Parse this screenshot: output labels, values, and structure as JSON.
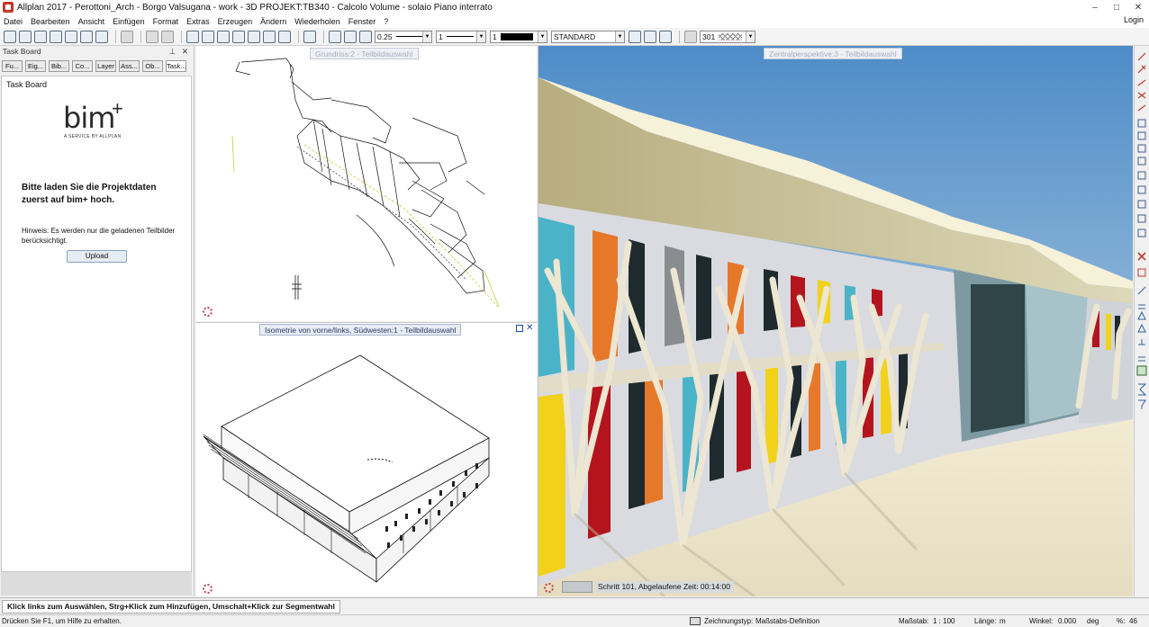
{
  "window": {
    "title": "Allplan 2017 - Perottoni_Arch - Borgo Valsugana - work - 3D PROJEKT:TB340 - Calcolo Volume - solaio Piano interrato",
    "minimize": "–",
    "maximize": "□",
    "close": "✕"
  },
  "menu": {
    "items": [
      "Datei",
      "Bearbeiten",
      "Ansicht",
      "Einfügen",
      "Format",
      "Extras",
      "Erzeugen",
      "Ändern",
      "Wiederholen",
      "Fenster",
      "?"
    ],
    "login": "Login"
  },
  "toolbar": {
    "pen_value": "0.25",
    "line_value": "1",
    "color_value": "1",
    "layer_value": "STANDARD",
    "hatch_value": "301"
  },
  "palette": {
    "title": "Task Board",
    "pin": "⊥",
    "close": "✕",
    "tabs": [
      "Fu...",
      "Eig...",
      "Bib...",
      "Co...",
      "Layer",
      "Ass...",
      "Ob...",
      "Task..."
    ]
  },
  "taskboard": {
    "header": "Task Board",
    "logo": "bim",
    "logo_sup": "+",
    "logo_sub": "A SERVICE BY ALLPLAN",
    "heading": "Bitte laden Sie die Projektdaten zuerst auf bim+ hoch.",
    "note": "Hinweis: Es werden nur die geladenen Teilbilder berücksichtigt.",
    "upload_label": "Upload"
  },
  "viewports": {
    "plan_label": "Grundriss:2 - Teilbildauswahl",
    "iso_label": "Isometrie von vorne/links, Südwesten:1 - Teilbildauswahl",
    "persp_label": "Zentralperspektive:3 - Teilbildauswahl",
    "render_status": "Schritt 101, Abgelaufene Zeit: 00:14:00"
  },
  "command": {
    "message": "Klick links zum Auswählen, Strg+Klick zum Hinzufügen, Umschalt+Klick zur Segmentwahl"
  },
  "status": {
    "help": "Drücken Sie F1, um Hilfe zu erhalten.",
    "drawing_type_label": "Zeichnungstyp:",
    "drawing_type_value": "Maßstabs-Definition",
    "scale_label": "Maßstab:",
    "scale_value": "1 : 100",
    "length_label": "Länge:",
    "length_value": "m",
    "angle_label": "Winkel:",
    "angle_value": "0.000",
    "angle_unit": "deg",
    "percent_label": "%:",
    "percent_value": "46"
  },
  "colors": {
    "sky_top": "#5a94cc",
    "panel_colors": [
      "#f2d11b",
      "#b4141e",
      "#e6782a",
      "#4bb3c8",
      "#8a8d90",
      "#1e2a2e"
    ]
  }
}
